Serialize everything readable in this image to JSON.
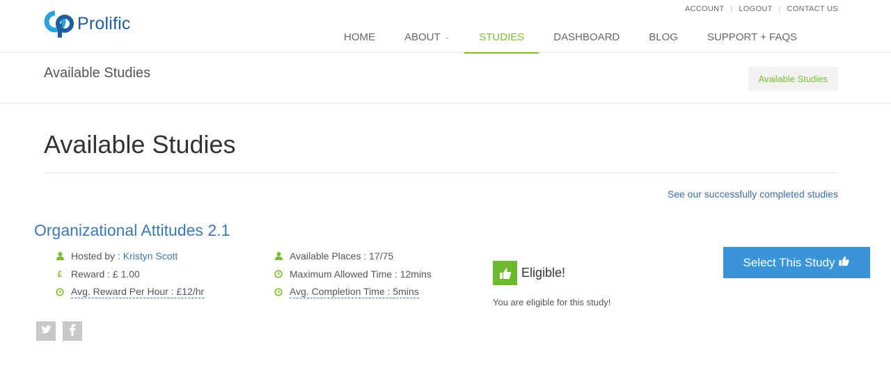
{
  "brand": {
    "name": "Prolific",
    "color": "#1f5e9c"
  },
  "top_links": [
    "ACCOUNT",
    "LOGOUT",
    "CONTACT US"
  ],
  "nav": {
    "items": [
      {
        "label": "HOME"
      },
      {
        "label": "ABOUT"
      },
      {
        "label": "STUDIES"
      },
      {
        "label": "DASHBOARD"
      },
      {
        "label": "BLOG"
      },
      {
        "label": "SUPPORT + FAQS"
      }
    ],
    "active": "STUDIES"
  },
  "titlebar": {
    "title": "Available Studies",
    "breadcrumb": "Available Studies"
  },
  "main": {
    "heading": "Available Studies",
    "completed_link": "See our successfully completed studies"
  },
  "study": {
    "title": "Organizational Attitudes 2.1",
    "hosted_by_label": "Hosted by : ",
    "host_name": "Kristyn Scott",
    "reward": "Reward : £ 1.00",
    "avg_reward_per_hour": "Avg. Reward Per Hour : £12/hr",
    "available_places": "Available Places : 17/75",
    "max_allowed_time": "Maximum Allowed Time : 12mins",
    "avg_completion_time": "Avg. Completion Time : 5mins",
    "eligible_label": "Eligible!",
    "eligible_message": "You are eligible for this study!",
    "select_button": "Select This Study"
  },
  "social": [
    "twitter-icon",
    "facebook-icon"
  ],
  "colors": {
    "accent_green": "#7dbb2e",
    "link_blue": "#3a78b5",
    "button_blue": "#3a94d8"
  }
}
